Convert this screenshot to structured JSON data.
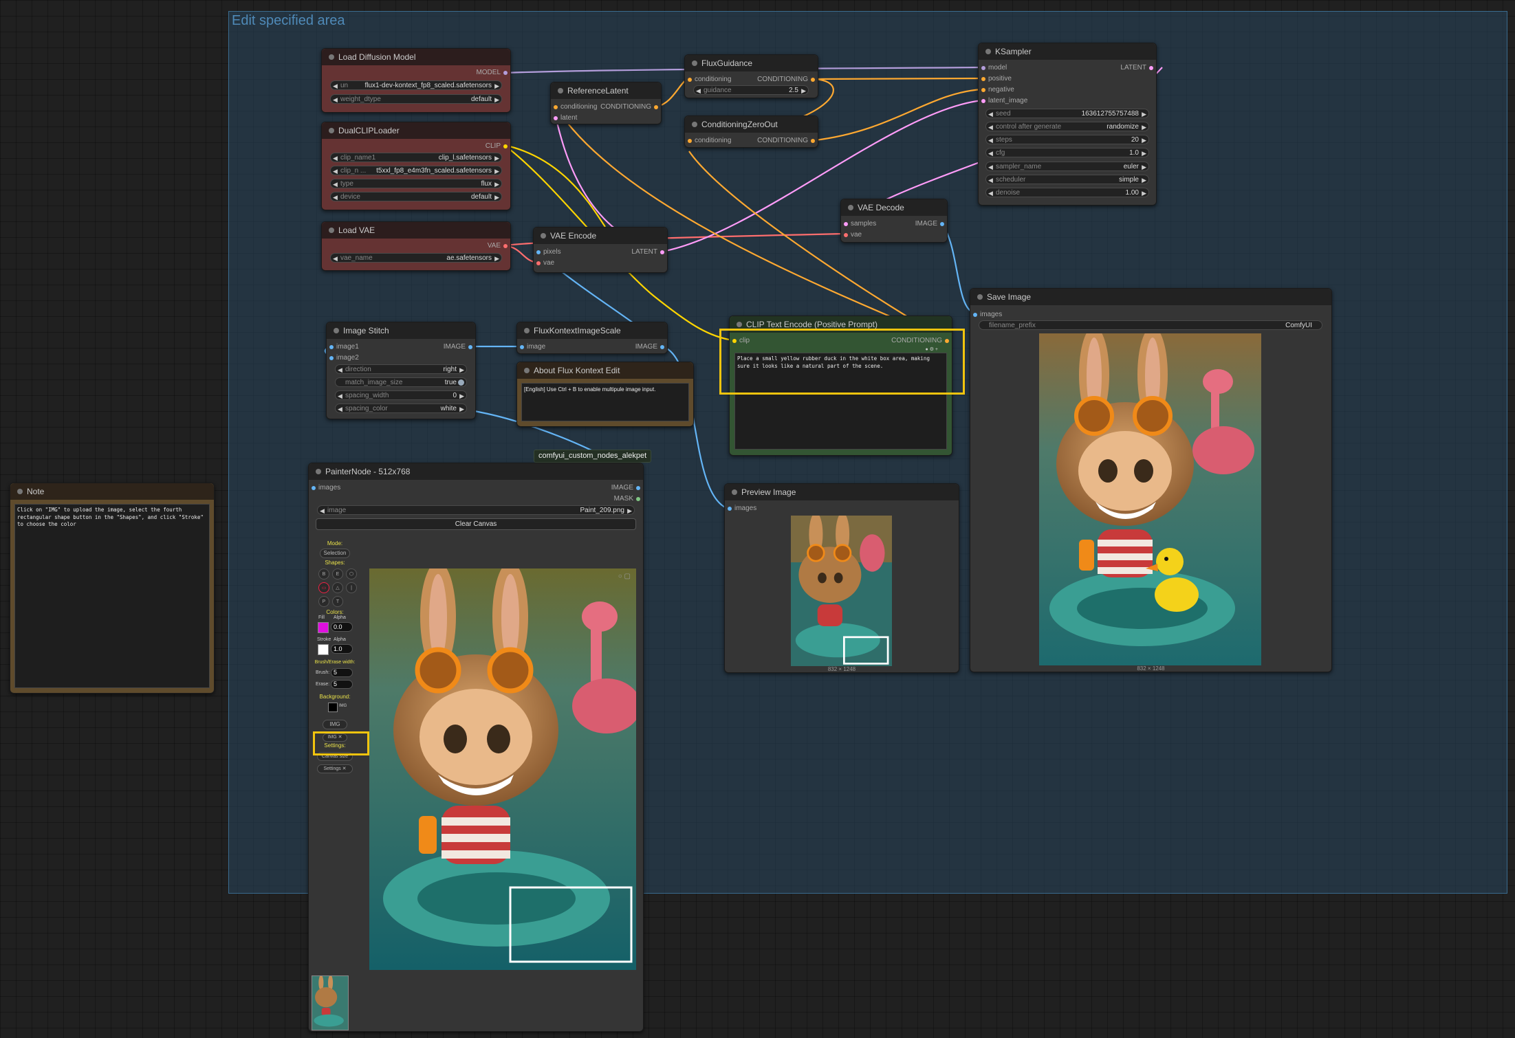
{
  "group": {
    "title": "Edit specified area"
  },
  "colors": {
    "model": "#b39ddb",
    "clip": "#ffd500",
    "conditioning": "#ffa931",
    "latent": "#ff9cf9",
    "vae": "#ff6e6e",
    "image": "#64b5f6",
    "mask": "#81c784",
    "highlight": "#f2c40e"
  },
  "load_diffusion": {
    "title": "Load Diffusion Model",
    "out_model": "MODEL",
    "unet_label": "un",
    "unet_value": "flux1-dev-kontext_fp8_scaled.safetensors",
    "dtype_label": "weight_dtype",
    "dtype_value": "default"
  },
  "dualclip": {
    "title": "DualCLIPLoader",
    "out_clip": "CLIP",
    "clip1_label": "clip_name1",
    "clip1_value": "clip_l.safetensors",
    "clip2_label": "clip_n ...",
    "clip2_value": "t5xxl_fp8_e4m3fn_scaled.safetensors",
    "type_label": "type",
    "type_value": "flux",
    "device_label": "device",
    "device_value": "default"
  },
  "load_vae": {
    "title": "Load VAE",
    "out_vae": "VAE",
    "vae_label": "vae_name",
    "vae_value": "ae.safetensors"
  },
  "reference_latent": {
    "title": "ReferenceLatent",
    "in_cond": "conditioning",
    "in_latent": "latent",
    "out_cond": "CONDITIONING"
  },
  "flux_guidance": {
    "title": "FluxGuidance",
    "in_cond": "conditioning",
    "out_cond": "CONDITIONING",
    "guidance_label": "guidance",
    "guidance_value": "2.5"
  },
  "cond_zero": {
    "title": "ConditioningZeroOut",
    "in_cond": "conditioning",
    "out_cond": "CONDITIONING"
  },
  "vae_encode": {
    "title": "VAE Encode",
    "in_pixels": "pixels",
    "in_vae": "vae",
    "out_latent": "LATENT"
  },
  "vae_decode": {
    "title": "VAE Decode",
    "in_samples": "samples",
    "in_vae": "vae",
    "out_image": "IMAGE"
  },
  "ksampler": {
    "title": "KSampler",
    "out_latent": "LATENT",
    "inputs": [
      "model",
      "positive",
      "negative",
      "latent_image"
    ],
    "widgets": [
      {
        "label": "seed",
        "value": "163612755757488"
      },
      {
        "label": "control after generate",
        "value": "randomize"
      },
      {
        "label": "steps",
        "value": "20"
      },
      {
        "label": "cfg",
        "value": "1.0"
      },
      {
        "label": "sampler_name",
        "value": "euler"
      },
      {
        "label": "scheduler",
        "value": "simple"
      },
      {
        "label": "denoise",
        "value": "1.00"
      }
    ]
  },
  "image_stitch": {
    "title": "Image Stitch",
    "in_image1": "image1",
    "in_image2": "image2",
    "out_image": "IMAGE",
    "widgets": [
      {
        "label": "direction",
        "value": "right"
      },
      {
        "label": "match_image_size",
        "value": "true"
      },
      {
        "label": "spacing_width",
        "value": "0"
      },
      {
        "label": "spacing_color",
        "value": "white"
      }
    ]
  },
  "flux_scale": {
    "title": "FluxKontextImageScale",
    "in_image": "image",
    "out_image": "IMAGE"
  },
  "about": {
    "title": "About Flux Kontext Edit",
    "text": "[English] Use Ctrl + B to enable multipule image input."
  },
  "clip_encode": {
    "title": "CLIP Text Encode (Positive Prompt)",
    "in_clip": "clip",
    "out_cond": "CONDITIONING",
    "prompt": "Place a small yellow rubber duck in the white box area, making sure it looks like a natural part of the scene."
  },
  "save_image": {
    "title": "Save Image",
    "in_images": "images",
    "prefix_label": "filename_prefix",
    "prefix_value": "ComfyUI",
    "caption": "832 × 1248"
  },
  "preview_image": {
    "title": "Preview Image",
    "in_images": "images",
    "caption": "832 × 1248"
  },
  "badge": "comfyui_custom_nodes_alekpet",
  "painter": {
    "title": "PainterNode - 512x768",
    "in_images": "images",
    "out_image": "IMAGE",
    "out_mask": "MASK",
    "image_label": "image",
    "image_value": "Paint_209.png",
    "clear": "Clear Canvas",
    "mode_label": "Mode:",
    "mode_value": "Selection",
    "shapes_label": "Shapes:",
    "shapes": [
      "B",
      "E",
      "⬡",
      "▭",
      "△",
      "|",
      "P",
      "T"
    ],
    "colors_label": "Colors:",
    "fill_label": "Fill",
    "alpha_label": "Alpha",
    "fill_alpha": "0.0",
    "stroke_label": "Stroke",
    "stroke_alpha": "1.0",
    "fill_color": "#e010e0",
    "stroke_color": "#ffffff",
    "bew_label": "Brush/Erase width:",
    "brush_label": "Brush:",
    "brush_value": "5",
    "erase_label": "Erase:",
    "erase_value": "5",
    "bg_label": "Background:",
    "bg_img": "IMG",
    "img_btn": "IMG",
    "img_x": "IMG ✕",
    "settings_label": "Settings:",
    "canvas_size": "Canvas size",
    "settings_btn": "Settings ✕"
  },
  "note": {
    "title": "Note",
    "text": "Click on \"IMG\" to upload the image, select the fourth rectangular shape button in the \"Shapes\", and click \"Stroke\" to choose the color"
  }
}
